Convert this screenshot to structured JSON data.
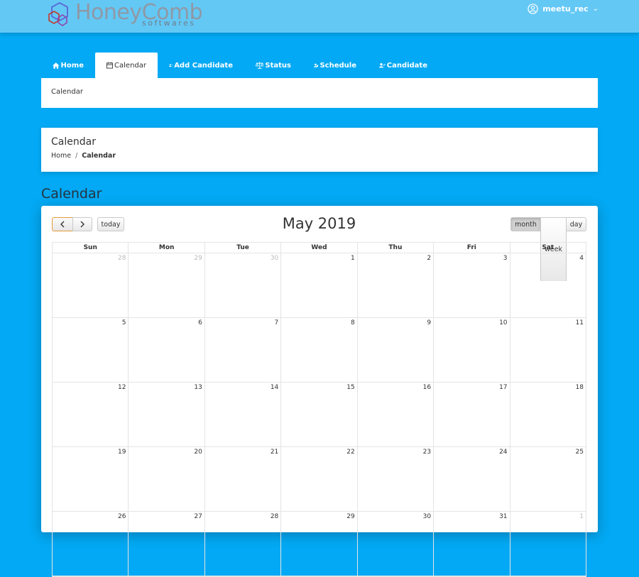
{
  "brand": {
    "name": "HoneyComb",
    "tagline": "softwares"
  },
  "user": {
    "name": "meetu_rec"
  },
  "nav": {
    "tabs": [
      {
        "label": "Home",
        "icon": "home-icon",
        "active": false
      },
      {
        "label": "Calendar",
        "icon": "calendar-icon",
        "active": true
      },
      {
        "label": "Add Candidate",
        "icon": "user-plus-icon",
        "active": false
      },
      {
        "label": "Status",
        "icon": "balance-scale-icon",
        "active": false
      },
      {
        "label": "Schedule",
        "icon": "user-clock-icon",
        "active": false
      },
      {
        "label": "Candidate",
        "icon": "user-check-icon",
        "active": false
      }
    ]
  },
  "tab_panel": {
    "text": "Calendar"
  },
  "page_header": {
    "title": "Calendar",
    "breadcrumb": [
      "Home",
      "Calendar"
    ]
  },
  "section_title": "Calendar",
  "calendar": {
    "title": "May 2019",
    "today_label": "today",
    "views": [
      "month",
      "week",
      "day"
    ],
    "active_view": "month",
    "weekdays": [
      "Sun",
      "Mon",
      "Tue",
      "Wed",
      "Thu",
      "Fri",
      "Sat"
    ],
    "weeks": [
      [
        {
          "d": "28",
          "other": true
        },
        {
          "d": "29",
          "other": true
        },
        {
          "d": "30",
          "other": true
        },
        {
          "d": "1"
        },
        {
          "d": "2"
        },
        {
          "d": "3"
        },
        {
          "d": "4"
        }
      ],
      [
        {
          "d": "5"
        },
        {
          "d": "6"
        },
        {
          "d": "7"
        },
        {
          "d": "8"
        },
        {
          "d": "9"
        },
        {
          "d": "10"
        },
        {
          "d": "11"
        }
      ],
      [
        {
          "d": "12"
        },
        {
          "d": "13"
        },
        {
          "d": "14"
        },
        {
          "d": "15"
        },
        {
          "d": "16"
        },
        {
          "d": "17"
        },
        {
          "d": "18"
        }
      ],
      [
        {
          "d": "19"
        },
        {
          "d": "20"
        },
        {
          "d": "21"
        },
        {
          "d": "22"
        },
        {
          "d": "23"
        },
        {
          "d": "24"
        },
        {
          "d": "25"
        }
      ],
      [
        {
          "d": "26"
        },
        {
          "d": "27"
        },
        {
          "d": "28"
        },
        {
          "d": "29"
        },
        {
          "d": "30"
        },
        {
          "d": "31"
        },
        {
          "d": "1",
          "other": true
        }
      ]
    ]
  },
  "colors": {
    "background": "#03a9f4",
    "topbar": "#64c8f5",
    "panel": "#ffffff"
  }
}
